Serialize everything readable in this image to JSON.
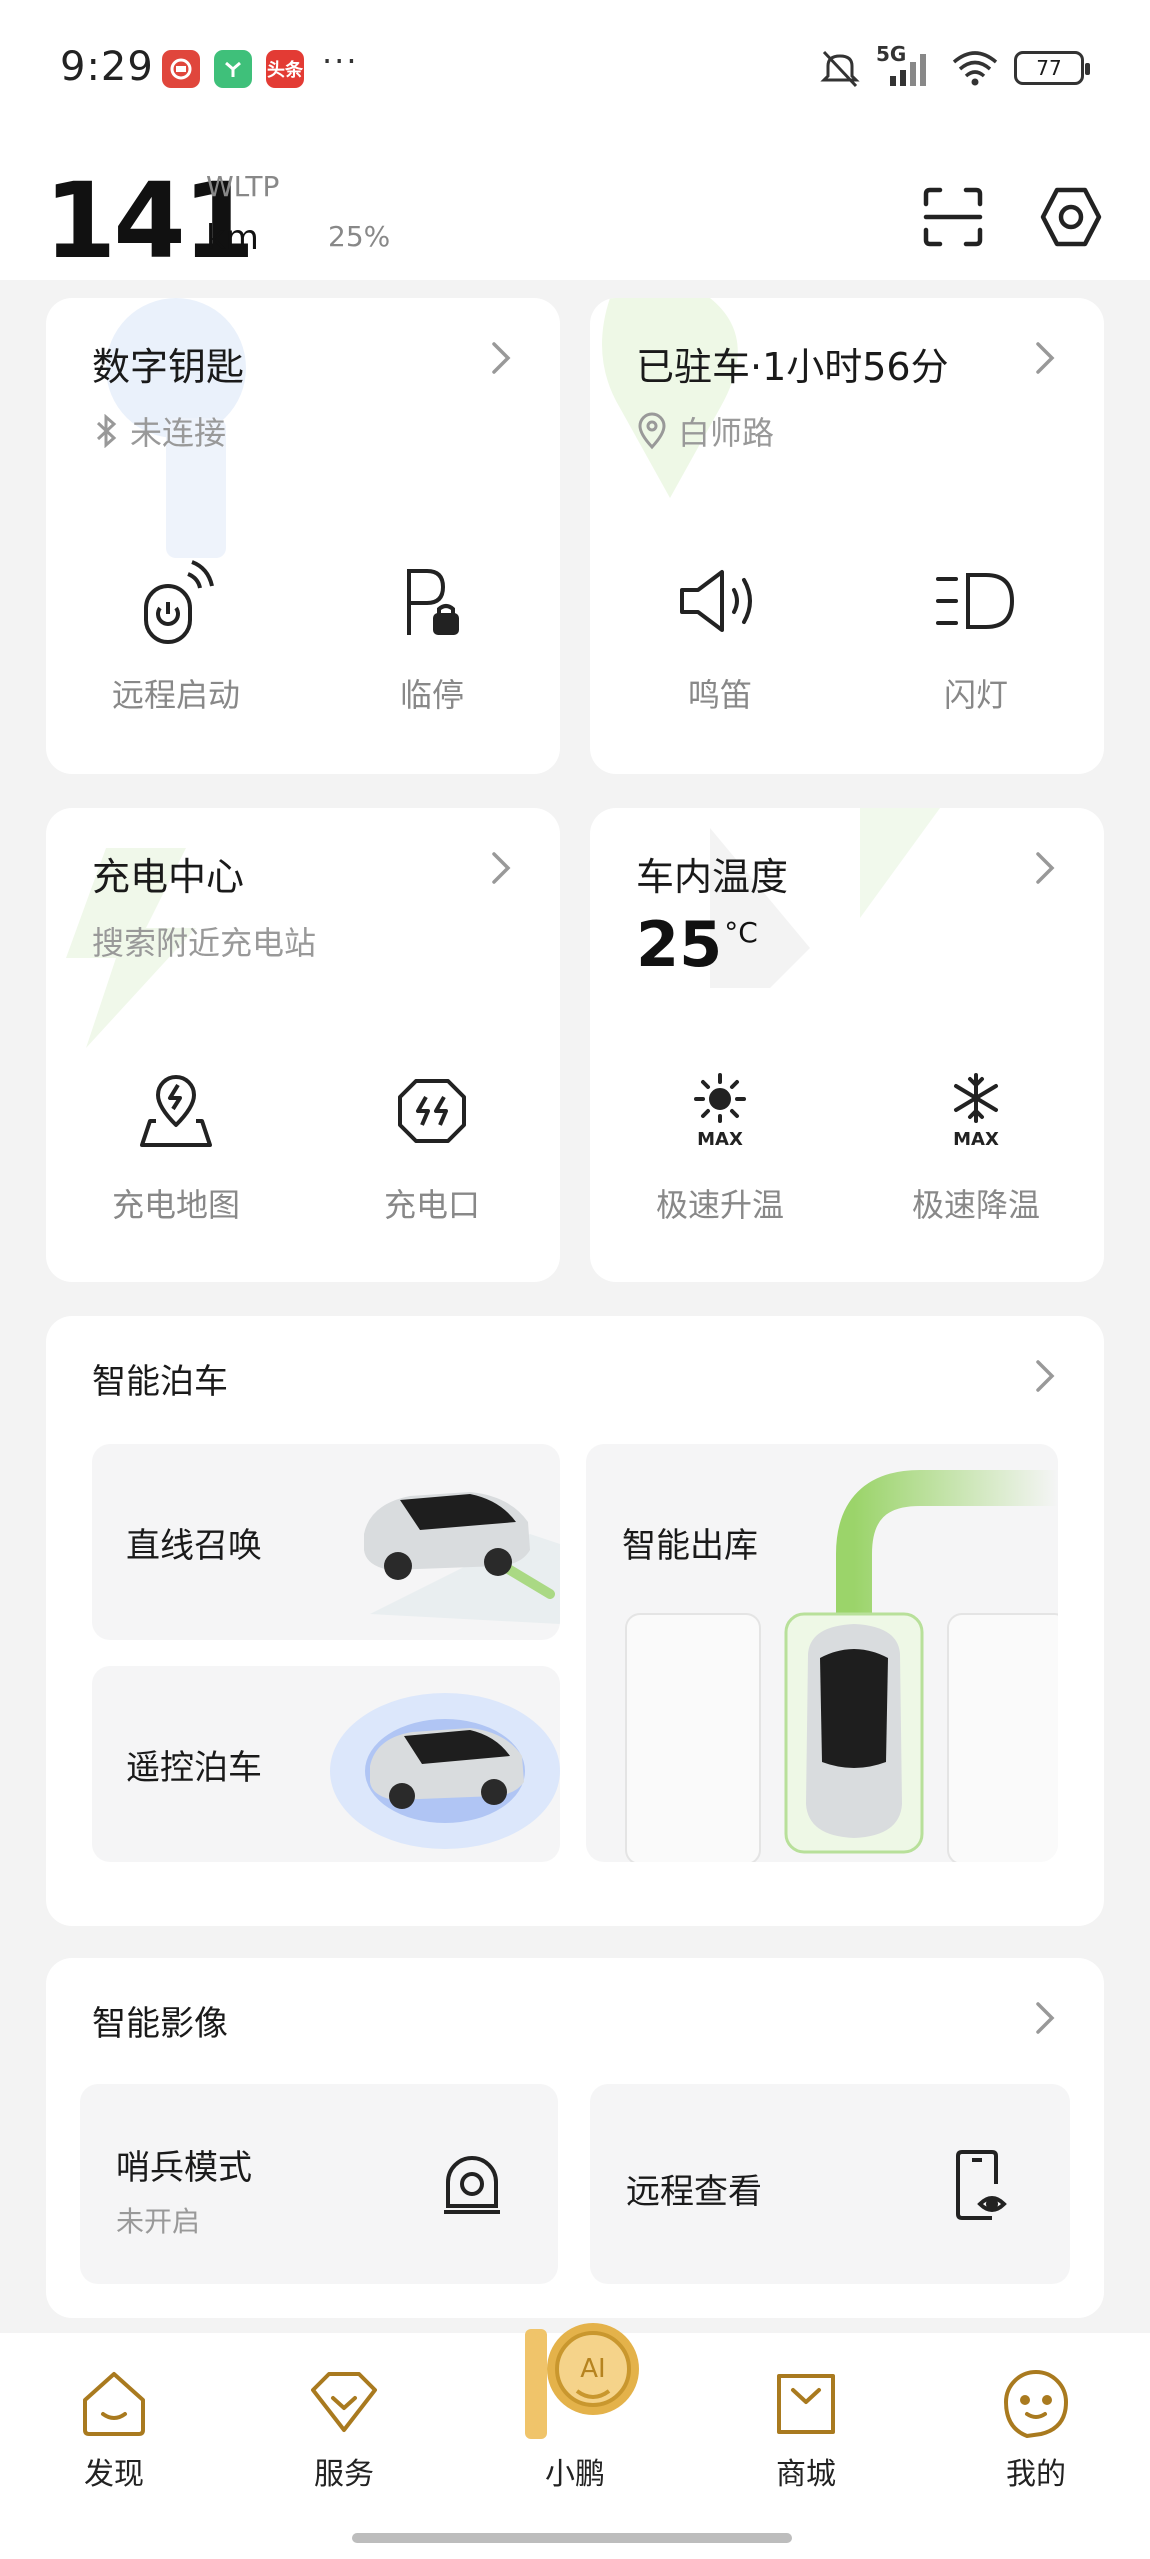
{
  "status": {
    "time": "9:29",
    "app_badges": [
      {
        "name": "app-badge-red",
        "color": "#e0463c",
        "text": ""
      },
      {
        "name": "app-badge-green",
        "color": "#3fc07a",
        "text": ""
      },
      {
        "name": "app-badge-toutiao",
        "color": "#e33b34",
        "text": "头条"
      }
    ],
    "more": "···",
    "network": "5G",
    "battery": "77"
  },
  "header": {
    "range_value": "141",
    "range_standard": "WLTP",
    "range_unit": "km",
    "battery_percent": "25%"
  },
  "digital_key": {
    "title": "数字钥匙",
    "status": "未连接",
    "actions": [
      {
        "label": "远程启动",
        "icon": "remote-start-icon"
      },
      {
        "label": "临停",
        "icon": "temp-parking-icon"
      }
    ]
  },
  "parking": {
    "title": "已驻车·1小时56分",
    "location": "白师路",
    "actions": [
      {
        "label": "鸣笛",
        "icon": "horn-icon"
      },
      {
        "label": "闪灯",
        "icon": "flash-lights-icon"
      }
    ]
  },
  "charging": {
    "title": "充电中心",
    "subtitle": "搜索附近充电站",
    "actions": [
      {
        "label": "充电地图",
        "icon": "charging-map-icon"
      },
      {
        "label": "充电口",
        "icon": "charging-port-icon"
      }
    ]
  },
  "climate": {
    "title": "车内温度",
    "temperature": "25",
    "unit": "°C",
    "actions": [
      {
        "label": "极速升温",
        "icon": "max-heat-icon",
        "badge": "MAX"
      },
      {
        "label": "极速降温",
        "icon": "max-cool-icon",
        "badge": "MAX"
      }
    ]
  },
  "smart_parking": {
    "title": "智能泊车",
    "tiles": {
      "summon": "直线召唤",
      "remote": "遥控泊车",
      "exit": "智能出库"
    }
  },
  "smart_camera": {
    "title": "智能影像",
    "sentry": {
      "label": "哨兵模式",
      "status": "未开启"
    },
    "remote_view": {
      "label": "远程查看"
    }
  },
  "nav": [
    {
      "label": "发现",
      "icon": "discover-icon"
    },
    {
      "label": "服务",
      "icon": "service-icon"
    },
    {
      "label": "小鹏",
      "icon": "xpeng-ai-icon",
      "badge": "AI"
    },
    {
      "label": "商城",
      "icon": "mall-icon"
    },
    {
      "label": "我的",
      "icon": "profile-icon"
    }
  ],
  "colors": {
    "accent_green": "#9bd46a",
    "ai_gold": "#d9a73a",
    "text_muted": "#999999"
  }
}
